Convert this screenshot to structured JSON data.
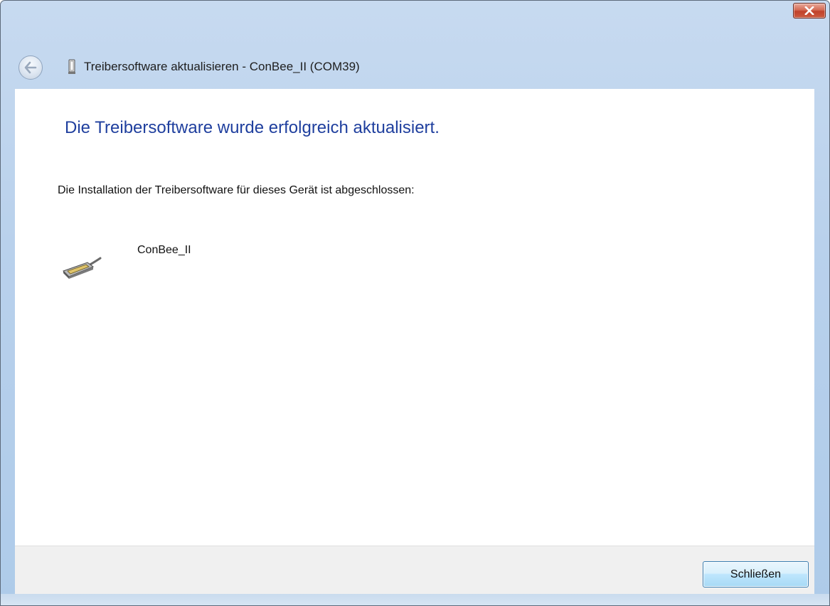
{
  "window": {
    "title": "Treibersoftware aktualisieren - ConBee_II (COM39)",
    "close_icon": "close-x-icon",
    "back_icon": "back-arrow-icon",
    "device_icon": "usb-device-icon"
  },
  "content": {
    "headline": "Die Treibersoftware wurde erfolgreich aktualisiert.",
    "message": "Die Installation der Treibersoftware für dieses Gerät ist abgeschlossen:",
    "device_name": "ConBee_II",
    "device_icon": "serial-connector-icon"
  },
  "footer": {
    "close_label": "Schließen"
  },
  "colors": {
    "headline": "#1f3f9e",
    "titlebar": "#b9d1ec",
    "close_button": "#c0422b",
    "footer_bg": "#f0f0f0"
  }
}
